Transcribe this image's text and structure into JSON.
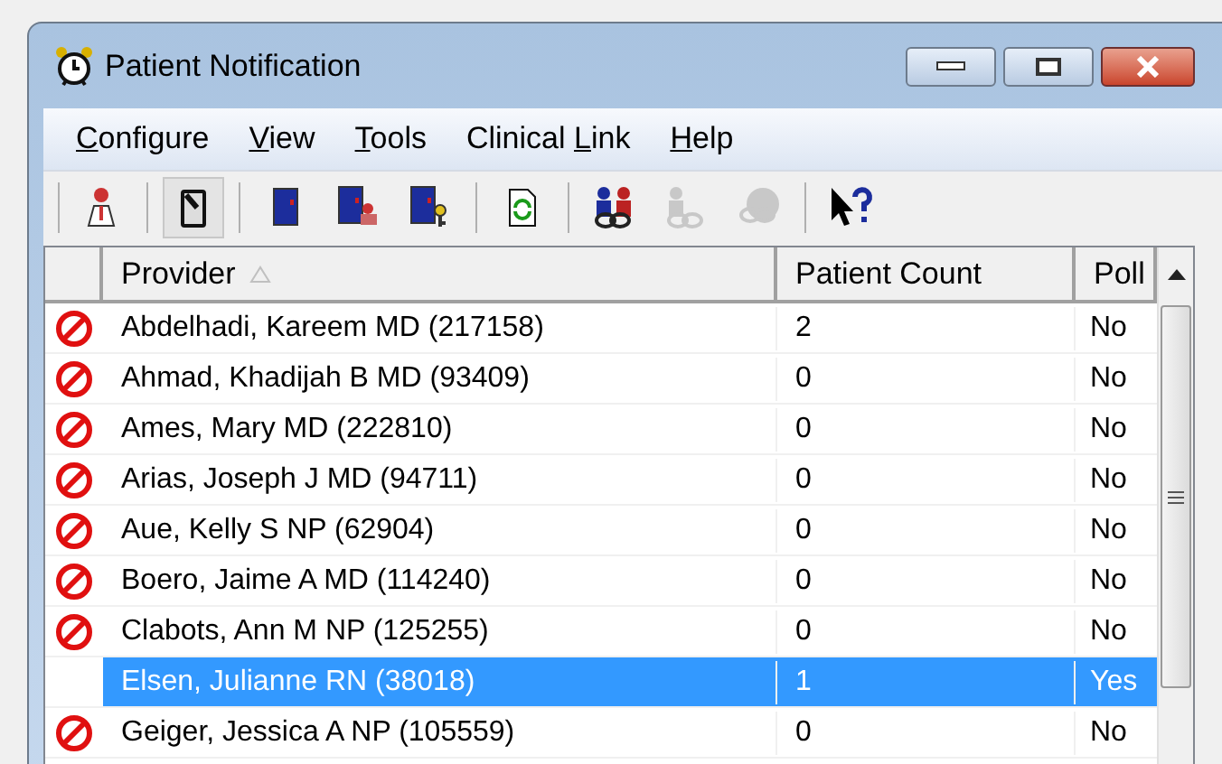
{
  "window": {
    "title": "Patient Notification"
  },
  "menu": [
    {
      "key": "C",
      "after": "onfigure"
    },
    {
      "key": "V",
      "after": "iew"
    },
    {
      "key": "T",
      "after": "ools"
    },
    {
      "before": "Clinical ",
      "key": "L",
      "after": "ink"
    },
    {
      "key": "H",
      "after": "elp"
    }
  ],
  "toolbar": [
    {
      "kind": "doctor",
      "pressed": false,
      "disabled": false
    },
    {
      "kind": "divider"
    },
    {
      "kind": "device",
      "pressed": true,
      "disabled": false
    },
    {
      "kind": "divider"
    },
    {
      "kind": "door",
      "pressed": false,
      "disabled": false
    },
    {
      "kind": "door-people",
      "pressed": false,
      "disabled": false
    },
    {
      "kind": "door-key",
      "pressed": false,
      "disabled": false
    },
    {
      "kind": "divider"
    },
    {
      "kind": "refresh",
      "pressed": false,
      "disabled": false
    },
    {
      "kind": "divider"
    },
    {
      "kind": "people-link",
      "pressed": false,
      "disabled": false
    },
    {
      "kind": "person-link",
      "pressed": false,
      "disabled": true
    },
    {
      "kind": "globe-link",
      "pressed": false,
      "disabled": true
    },
    {
      "kind": "divider"
    },
    {
      "kind": "help",
      "pressed": false,
      "disabled": false
    }
  ],
  "table": {
    "columns": [
      {
        "label": "Provider",
        "sorted": true
      },
      {
        "label": "Patient Count"
      },
      {
        "label": "Poll"
      }
    ],
    "rows": [
      {
        "provider": "Abdelhadi, Kareem MD (217158)",
        "count": "2",
        "poll": "No",
        "blocked": true,
        "selected": false
      },
      {
        "provider": "Ahmad, Khadijah B MD (93409)",
        "count": "0",
        "poll": "No",
        "blocked": true,
        "selected": false
      },
      {
        "provider": "Ames, Mary MD (222810)",
        "count": "0",
        "poll": "No",
        "blocked": true,
        "selected": false
      },
      {
        "provider": "Arias, Joseph J MD (94711)",
        "count": "0",
        "poll": "No",
        "blocked": true,
        "selected": false
      },
      {
        "provider": "Aue, Kelly S NP (62904)",
        "count": "0",
        "poll": "No",
        "blocked": true,
        "selected": false
      },
      {
        "provider": "Boero, Jaime A MD (114240)",
        "count": "0",
        "poll": "No",
        "blocked": true,
        "selected": false
      },
      {
        "provider": "Clabots, Ann M NP (125255)",
        "count": "0",
        "poll": "No",
        "blocked": true,
        "selected": false
      },
      {
        "provider": "Elsen, Julianne RN (38018)",
        "count": "1",
        "poll": "Yes",
        "blocked": false,
        "selected": true
      },
      {
        "provider": "Geiger, Jessica A NP (105559)",
        "count": "0",
        "poll": "No",
        "blocked": true,
        "selected": false
      }
    ]
  }
}
